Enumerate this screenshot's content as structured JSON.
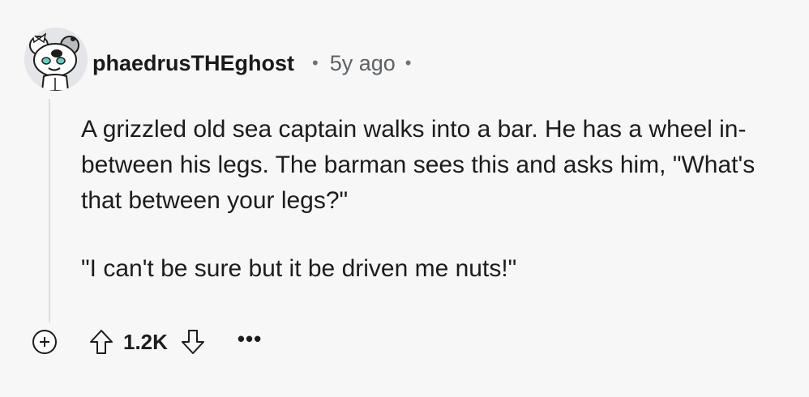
{
  "comment": {
    "username": "phaedrusTHEghost",
    "separator_1": "•",
    "timestamp": "5y ago",
    "separator_2": "•",
    "avatar_icon": "snoo-koala-avatar",
    "paragraphs": [
      "A grizzled old sea captain walks into a bar. He has a wheel in-between his legs. The barman sees this and asks him, \"What's that between your legs?\"",
      "\"I can't be sure but it be driven me nuts!\""
    ]
  },
  "actions": {
    "expand_icon": "plus-circle-icon",
    "upvote_icon": "arrow-up-outline-icon",
    "score": "1.2K",
    "downvote_icon": "arrow-down-outline-icon",
    "more_label": "•••"
  },
  "colors": {
    "background": "#f7f7f8",
    "text": "#1c1c1c",
    "meta": "#5c6166",
    "thread_line": "#dcdfe2"
  }
}
